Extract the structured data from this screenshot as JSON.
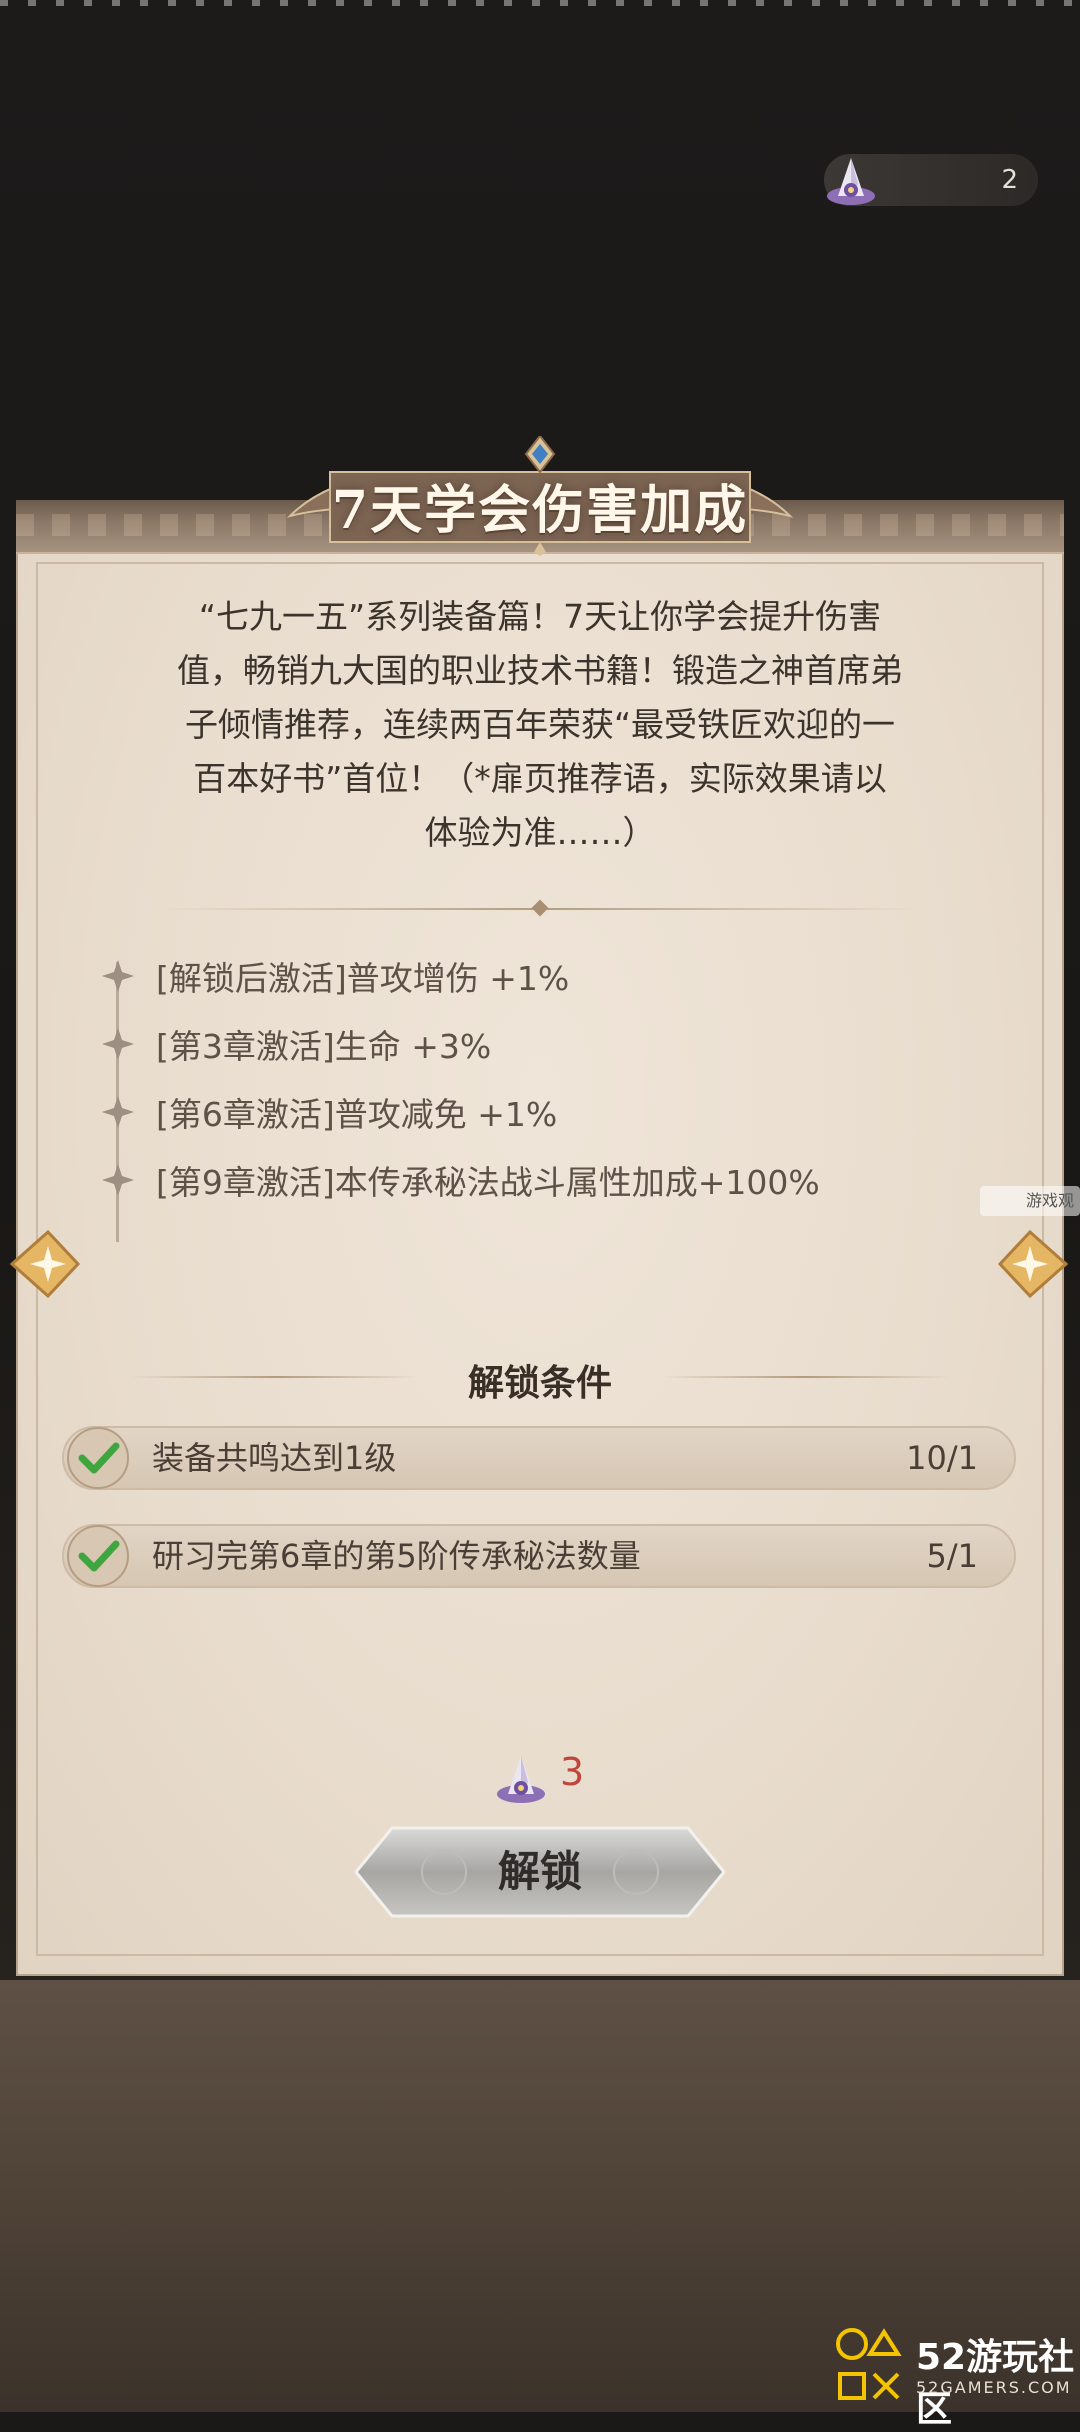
{
  "currency": {
    "amount": "2",
    "icon": "crystal-icon"
  },
  "title": "7天学会伤害加成",
  "description_lines": [
    "“七九一五”系列装备篇！7天让你学会提升伤害",
    "值，畅销九大国的职业技术书籍！锻造之神首席弟",
    "子倾情推荐，连续两百年荣获“最受铁匠欢迎的一",
    "百本好书”首位！（*扉页推荐语，实际效果请以",
    "体验为准……）"
  ],
  "bonuses": [
    "[解锁后激活]普攻增伤 +1%",
    "[第3章激活]生命 +3%",
    "[第6章激活]普攻减免 +1%",
    "[第9章激活]本传承秘法战斗属性加成+100%"
  ],
  "conditions_title": "解锁条件",
  "conditions": [
    {
      "label": "装备共鸣达到1级",
      "count": "10/1"
    },
    {
      "label": "研习完第6章的第5阶传承秘法数量",
      "count": "5/1"
    }
  ],
  "cost": {
    "amount": "3",
    "icon": "crystal-icon"
  },
  "unlock_button": "解锁",
  "watermarks": {
    "side": "游戏观",
    "brand": "52游玩社区",
    "brand_url": "52GAMERS.COM"
  },
  "colors": {
    "cost_red": "#c0453a",
    "check_green": "#3fa53f",
    "panel": "#ebe0d2"
  }
}
